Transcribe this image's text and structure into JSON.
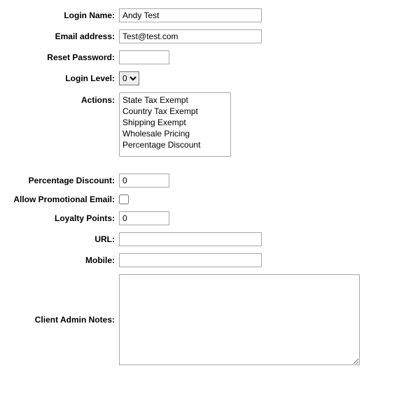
{
  "form": {
    "login_name": {
      "label": "Login Name:",
      "value": "Andy Test"
    },
    "email": {
      "label": "Email address:",
      "value": "Test@test.com"
    },
    "reset_password": {
      "label": "Reset Password:",
      "value": ""
    },
    "login_level": {
      "label": "Login Level:",
      "selected": "0"
    },
    "actions": {
      "label": "Actions:",
      "options": [
        "State Tax Exempt",
        "Country Tax Exempt",
        "Shipping Exempt",
        "Wholesale Pricing",
        "Percentage Discount"
      ]
    },
    "percentage_discount": {
      "label": "Percentage Discount:",
      "value": "0"
    },
    "allow_promo": {
      "label": "Allow Promotional Email:",
      "checked": false
    },
    "loyalty_points": {
      "label": "Loyalty Points:",
      "value": "0"
    },
    "url": {
      "label": "URL:",
      "value": ""
    },
    "mobile": {
      "label": "Mobile:",
      "value": ""
    },
    "notes": {
      "label": "Client Admin Notes:",
      "value": ""
    }
  }
}
